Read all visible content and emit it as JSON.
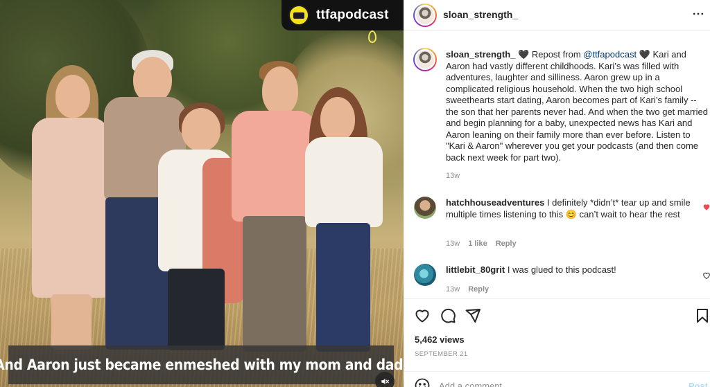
{
  "media": {
    "overlay_account": "ttfapodcast",
    "subtitle": "And Aaron just became enmeshed with my mom and dad.",
    "mute_icon": "speaker-muted-icon"
  },
  "header": {
    "username": "sloan_strength_",
    "more_icon": "more-options-icon"
  },
  "caption": {
    "username": "sloan_strength_",
    "heart1": "🖤",
    "repost_prefix": " Repost from ",
    "mention": "@ttfapodcast",
    "heart2": "🖤",
    "text": " Kari and Aaron had vastly different childhoods. Kari’s was filled with adventures, laughter and silliness. Aaron grew up in a complicated religious household. When the two high school sweethearts start dating, Aaron becomes part of Kari’s family -- the son that her parents never had. And when the two get married and begin planning for a baby, unexpected news has Kari and Aaron leaning on their family more than ever before. Listen to \"Kari & Aaron\" wherever you get your podcasts (and then come back next week for part two).",
    "time": "13w"
  },
  "comments": [
    {
      "username": "hatchhouseadventures",
      "text": "I definitely *didn’t* tear up and smile multiple times listening to this 😊 can’t wait to hear the rest",
      "time": "13w",
      "likes": "1 like",
      "reply": "Reply",
      "liked": true,
      "heart_color": "#ed4956"
    },
    {
      "username": "littlebit_80grit",
      "text": "I was glued to this podcast!",
      "time": "13w",
      "reply": "Reply",
      "liked": false
    }
  ],
  "actions": {
    "like_icon": "heart-icon",
    "comment_icon": "comment-icon",
    "share_icon": "send-icon",
    "save_icon": "bookmark-icon",
    "views": "5,462 views",
    "date": "SEPTEMBER 21"
  },
  "add_comment": {
    "emoji_icon": "emoji-icon",
    "placeholder": "Add a comment…",
    "post_label": "Post"
  },
  "colors": {
    "text": "#262626",
    "secondary": "#8e8e8e",
    "link": "#00376b",
    "post_disabled": "#b2dffc",
    "like_red": "#ed4956"
  }
}
